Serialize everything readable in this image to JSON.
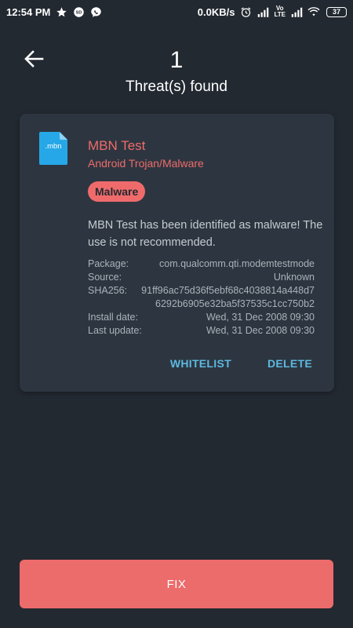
{
  "status_bar": {
    "time": "12:54 PM",
    "network_speed": "0.0KB/s",
    "volte_top": "Vo",
    "volte_bottom": "LTE",
    "battery": "37"
  },
  "header": {
    "threat_count": "1",
    "threat_label": "Threat(s) found"
  },
  "threat": {
    "file_ext": ".mbn",
    "app_name": "MBN Test",
    "threat_type": "Android Trojan/Malware",
    "badge": "Malware",
    "description": "MBN Test has been identified as malware! The use is not recommended.",
    "details": {
      "package_label": "Package:",
      "package_value": "com.qualcomm.qti.modemtestmode",
      "source_label": "Source:",
      "source_value": "Unknown",
      "sha_label": "SHA256:",
      "sha_value": "91ff96ac75d36f5ebf68c4038814a448d7 6292b6905e32ba5f37535c1cc750b2",
      "install_label": "Install date:",
      "install_value": "Wed, 31 Dec 2008 09:30",
      "update_label": "Last update:",
      "update_value": "Wed, 31 Dec 2008 09:30"
    },
    "actions": {
      "whitelist": "WHITELIST",
      "delete": "DELETE"
    }
  },
  "fix_button": "FIX",
  "colors": {
    "background": "#232931",
    "card": "#2d3640",
    "accent_red": "#ef6b6b",
    "action_blue": "#5db8e0"
  },
  "icons": [
    "star-icon",
    "mi-chat-icon",
    "phone-bubble-icon",
    "alarm-icon",
    "signal-icon",
    "wifi-icon",
    "back-arrow-icon",
    "file-icon"
  ]
}
